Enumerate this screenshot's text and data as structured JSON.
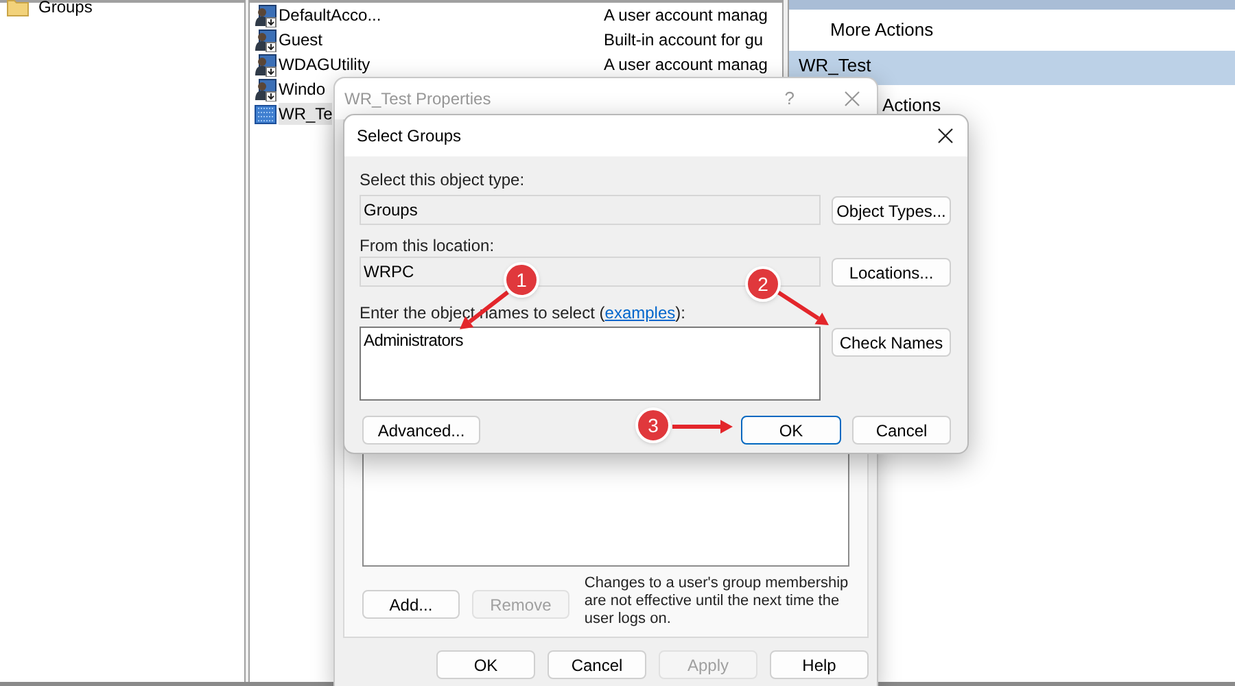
{
  "tree": {
    "items": [
      {
        "label": "Groups"
      }
    ]
  },
  "list": {
    "rows": [
      {
        "name": "DefaultAcco...",
        "description": "A user account manag",
        "selected": false
      },
      {
        "name": "Guest",
        "description": "Built-in account for gu",
        "selected": false
      },
      {
        "name": "WDAGUtility",
        "description": "A user account manag",
        "selected": false
      },
      {
        "name": "Windo",
        "selected": false
      },
      {
        "name": "WR_Te",
        "selected": true
      }
    ]
  },
  "actions": {
    "items": [
      {
        "kind": "link",
        "label": "More Actions"
      },
      {
        "kind": "header",
        "label": "WR_Test"
      },
      {
        "kind": "link",
        "label": "Actions"
      }
    ]
  },
  "properties_dialog": {
    "title": "WR_Test Properties",
    "help": "?",
    "buttons": [
      {
        "label": "Add...",
        "disabled": false
      },
      {
        "label": "Remove",
        "disabled": true
      }
    ],
    "note": "Changes to a user's group membership are not effective until the next time the user logs on.",
    "footer_buttons": [
      {
        "label": "OK",
        "disabled": false
      },
      {
        "label": "Cancel",
        "disabled": false
      },
      {
        "label": "Apply",
        "disabled": true
      },
      {
        "label": "Help",
        "disabled": false
      }
    ]
  },
  "select_dialog": {
    "title": "Select Groups",
    "object_type": {
      "label": "Select this object type:",
      "value": "Groups",
      "button": "Object Types..."
    },
    "location": {
      "label": "From this location:",
      "value": "WRPC",
      "button": "Locations..."
    },
    "names": {
      "label_before": "Enter the object names to select (",
      "link": "examples",
      "label_after": "):",
      "value": "Administrators",
      "button": "Check Names"
    },
    "buttons": [
      {
        "label": "Advanced...",
        "default": false
      },
      {
        "label": "OK",
        "default": true
      },
      {
        "label": "Cancel",
        "default": false
      }
    ]
  },
  "callouts": [
    {
      "label": "1"
    },
    {
      "label": "2"
    },
    {
      "label": "3"
    }
  ]
}
